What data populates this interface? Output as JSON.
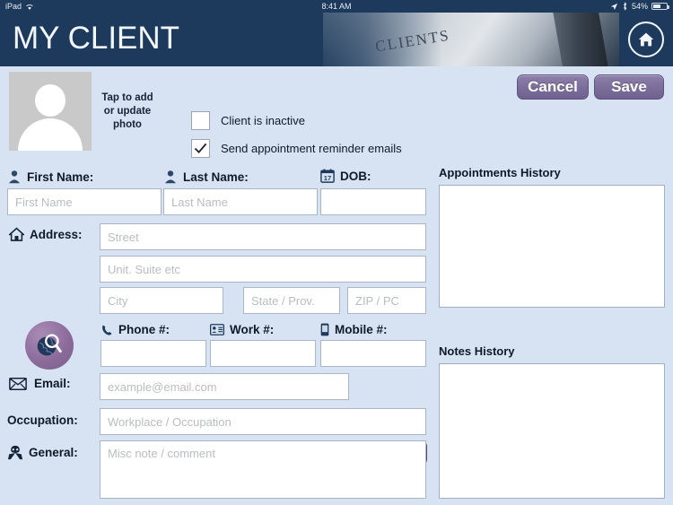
{
  "statusbar": {
    "device": "iPad",
    "wifi_icon": "wifi-icon",
    "time": "8:41 AM",
    "location_icon": "location-arrow-icon",
    "bluetooth_icon": "bluetooth-icon",
    "battery_text": "54%",
    "battery_icon": "battery-icon"
  },
  "header": {
    "title": "MY CLIENT",
    "banner_word": "CLIENTS",
    "home_icon": "home-icon"
  },
  "toolbar": {
    "cancel_label": "Cancel",
    "save_label": "Save"
  },
  "photo": {
    "avatar_icon": "person-placeholder-icon",
    "caption": "Tap to add\nor update\nphoto",
    "caption_line1": "Tap to add",
    "caption_line2": "or update",
    "caption_line3": "photo"
  },
  "checkboxes": [
    {
      "label": "Client is inactive",
      "checked": false
    },
    {
      "label": "Send appointment reminder emails",
      "checked": true
    }
  ],
  "fields": {
    "first_name": {
      "label": "First Name:",
      "placeholder": "First Name",
      "value": "",
      "icon": "person-icon"
    },
    "last_name": {
      "label": "Last Name:",
      "placeholder": "Last Name",
      "value": "",
      "icon": "person-icon"
    },
    "dob": {
      "label": "DOB:",
      "placeholder": "",
      "value": "",
      "icon": "calendar-icon",
      "icon_day": "17"
    },
    "address": {
      "label": "Address:",
      "icon": "home-icon"
    },
    "street": {
      "placeholder": "Street",
      "value": ""
    },
    "unit": {
      "placeholder": "Unit. Suite etc",
      "value": ""
    },
    "city": {
      "placeholder": "City",
      "value": ""
    },
    "state": {
      "placeholder": "State / Prov.",
      "value": ""
    },
    "zip": {
      "placeholder": "ZIP / PC",
      "value": ""
    },
    "phone": {
      "label": "Phone #:",
      "placeholder": "",
      "value": "",
      "icon": "phone-handset-icon"
    },
    "work": {
      "label": "Work #:",
      "placeholder": "",
      "value": "",
      "icon": "contact-card-icon"
    },
    "mobile": {
      "label": "Mobile #:",
      "placeholder": "",
      "value": "",
      "icon": "mobile-phone-icon"
    },
    "email": {
      "label": "Email:",
      "placeholder": "example@email.com",
      "value": "",
      "icon": "envelope-icon"
    },
    "occupation": {
      "label": "Occupation:",
      "placeholder": "Workplace / Occupation",
      "value": ""
    },
    "general": {
      "label": "General:",
      "placeholder": "Misc note / comment",
      "value": "",
      "icon": "person-bust-icon"
    }
  },
  "buttons": {
    "email_label": "Email",
    "map_search_icon": "globe-search-icon"
  },
  "panels": {
    "appointments_title": "Appointments History",
    "appointments_items": [],
    "notes_title": "Notes History",
    "notes_items": []
  },
  "colors": {
    "header_navy": "#1d3a5c",
    "page_background": "#d7e3f2",
    "button_purple": "#7d6f9b",
    "field_border": "#a9b6c6",
    "label_text": "#0f1a26"
  }
}
